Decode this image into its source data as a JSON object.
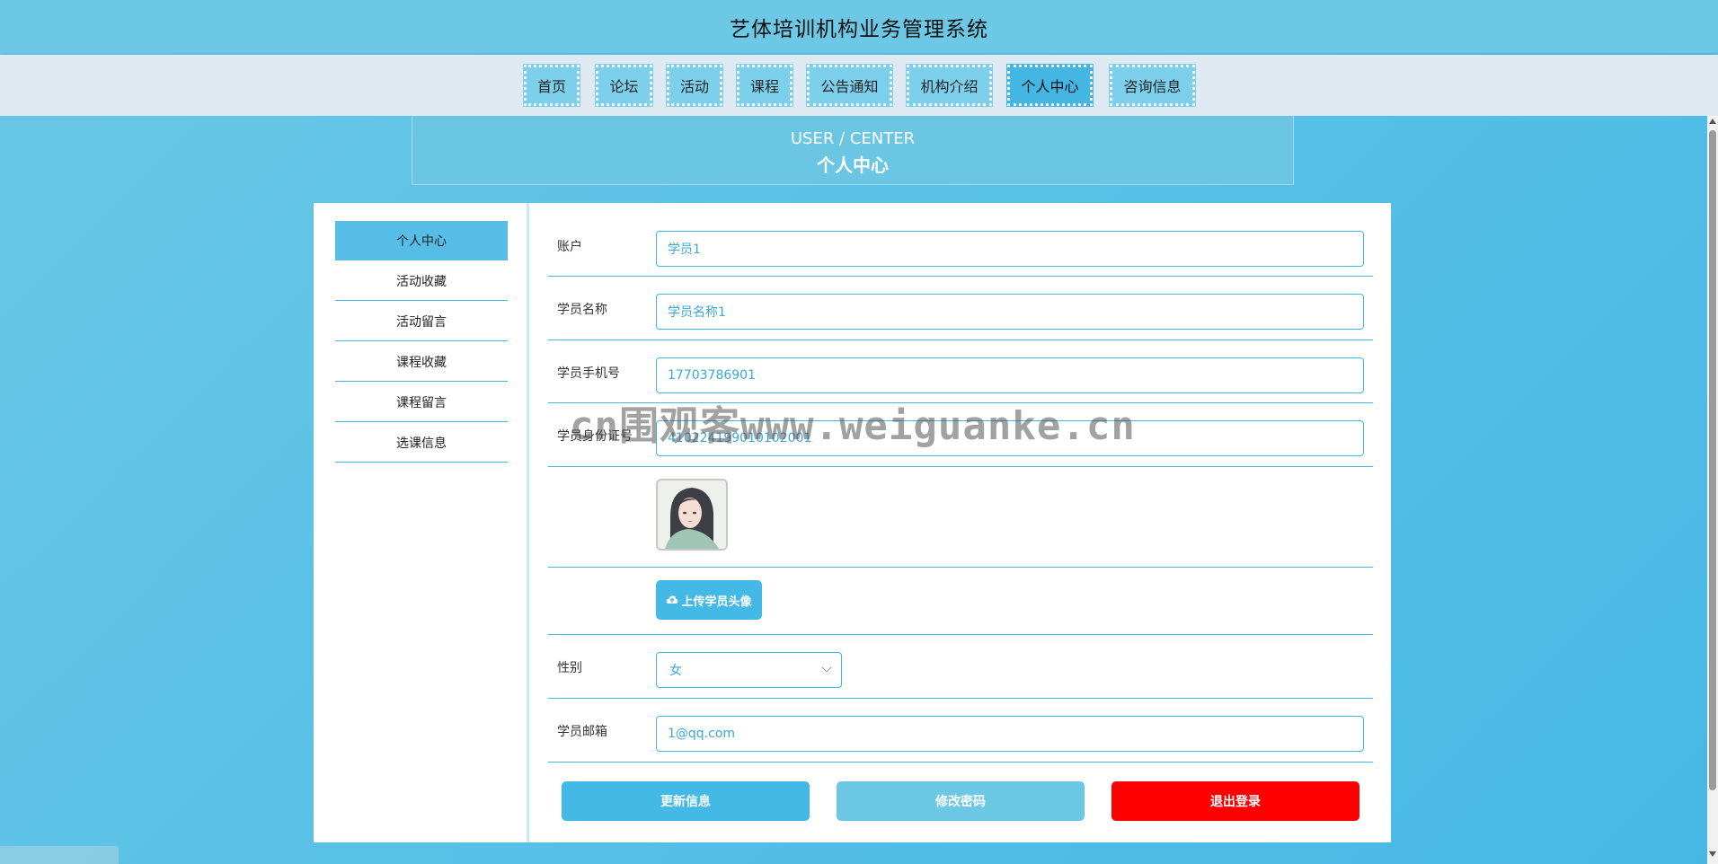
{
  "app": {
    "title": "艺体培训机构业务管理系统"
  },
  "nav": {
    "items": [
      {
        "label": "首页"
      },
      {
        "label": "论坛"
      },
      {
        "label": "活动"
      },
      {
        "label": "课程"
      },
      {
        "label": "公告通知"
      },
      {
        "label": "机构介绍"
      },
      {
        "label": "个人中心",
        "active": true
      },
      {
        "label": "咨询信息"
      }
    ]
  },
  "banner": {
    "en": "USER / CENTER",
    "zh": "个人中心"
  },
  "sidebar": {
    "items": [
      {
        "label": "个人中心",
        "active": true
      },
      {
        "label": "活动收藏"
      },
      {
        "label": "活动留言"
      },
      {
        "label": "课程收藏"
      },
      {
        "label": "课程留言"
      },
      {
        "label": "选课信息"
      }
    ]
  },
  "form": {
    "account": {
      "label": "账户",
      "value": "学员1"
    },
    "name": {
      "label": "学员名称",
      "value": "学员名称1"
    },
    "phone": {
      "label": "学员手机号",
      "value": "17703786901"
    },
    "id_card": {
      "label": "学员身份证号",
      "value": "410224199010102001"
    },
    "upload_label": "上传学员头像",
    "gender": {
      "label": "性别",
      "value": "女"
    },
    "email": {
      "label": "学员邮箱",
      "value": "1@qq.com"
    }
  },
  "actions": {
    "update": "更新信息",
    "change_password": "修改密码",
    "logout": "退出登录"
  },
  "watermark": "cn围观客www.weiguanke.cn",
  "colors": {
    "accent": "#45b9e6",
    "nav_bg": "#7cd0eb",
    "nav_active": "#43b6e3",
    "logout": "#ff0000",
    "secondary_btn": "#6cc8e5"
  },
  "icons": {
    "upload": "cloud-upload-icon",
    "select": "chevron-down-icon",
    "avatar": "avatar-image"
  }
}
